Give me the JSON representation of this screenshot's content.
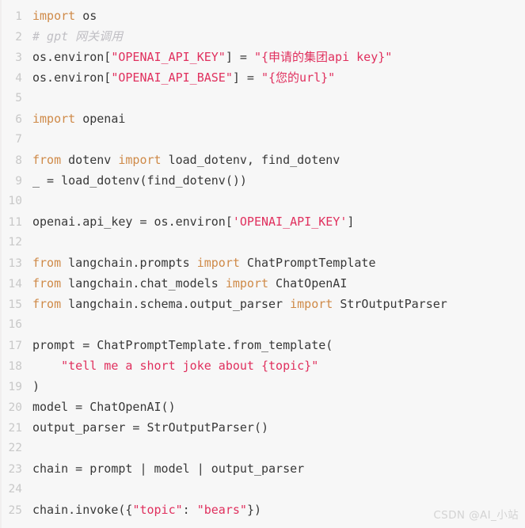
{
  "editor": {
    "language": "python",
    "background_color": "#f7f7f7",
    "default_text_color": "#383838",
    "keyword_color": "#cf8a48",
    "string_color": "#e0305e",
    "comment_color": "#c0bfc4",
    "line_number_color": "#c8c8c8",
    "lines": [
      {
        "number": "1",
        "tokens": [
          {
            "t": "import",
            "c": "kw"
          },
          {
            "t": " os",
            "c": "txt"
          }
        ]
      },
      {
        "number": "2",
        "tokens": [
          {
            "t": "# gpt 网关调用",
            "c": "cmt"
          }
        ]
      },
      {
        "number": "3",
        "tokens": [
          {
            "t": "os.environ[",
            "c": "txt"
          },
          {
            "t": "\"OPENAI_API_KEY\"",
            "c": "str"
          },
          {
            "t": "] = ",
            "c": "txt"
          },
          {
            "t": "\"{申请的集团api key}\"",
            "c": "str"
          }
        ]
      },
      {
        "number": "4",
        "tokens": [
          {
            "t": "os.environ[",
            "c": "txt"
          },
          {
            "t": "\"OPENAI_API_BASE\"",
            "c": "str"
          },
          {
            "t": "] = ",
            "c": "txt"
          },
          {
            "t": "\"{您的url}\"",
            "c": "str"
          }
        ]
      },
      {
        "number": "5",
        "tokens": []
      },
      {
        "number": "6",
        "tokens": [
          {
            "t": "import",
            "c": "kw"
          },
          {
            "t": " openai",
            "c": "txt"
          }
        ]
      },
      {
        "number": "7",
        "tokens": []
      },
      {
        "number": "8",
        "tokens": [
          {
            "t": "from",
            "c": "kw"
          },
          {
            "t": " dotenv ",
            "c": "txt"
          },
          {
            "t": "import",
            "c": "kw"
          },
          {
            "t": " load_dotenv, find_dotenv",
            "c": "txt"
          }
        ]
      },
      {
        "number": "9",
        "tokens": [
          {
            "t": "_ = load_dotenv(find_dotenv())",
            "c": "txt"
          }
        ]
      },
      {
        "number": "10",
        "tokens": []
      },
      {
        "number": "11",
        "tokens": [
          {
            "t": "openai.api_key = os.environ[",
            "c": "txt"
          },
          {
            "t": "'OPENAI_API_KEY'",
            "c": "str"
          },
          {
            "t": "]",
            "c": "txt"
          }
        ]
      },
      {
        "number": "12",
        "tokens": []
      },
      {
        "number": "13",
        "tokens": [
          {
            "t": "from",
            "c": "kw"
          },
          {
            "t": " langchain.prompts ",
            "c": "txt"
          },
          {
            "t": "import",
            "c": "kw"
          },
          {
            "t": " ChatPromptTemplate",
            "c": "txt"
          }
        ]
      },
      {
        "number": "14",
        "tokens": [
          {
            "t": "from",
            "c": "kw"
          },
          {
            "t": " langchain.chat_models ",
            "c": "txt"
          },
          {
            "t": "import",
            "c": "kw"
          },
          {
            "t": " ChatOpenAI",
            "c": "txt"
          }
        ]
      },
      {
        "number": "15",
        "tokens": [
          {
            "t": "from",
            "c": "kw"
          },
          {
            "t": " langchain.schema.output_parser ",
            "c": "txt"
          },
          {
            "t": "import",
            "c": "kw"
          },
          {
            "t": " StrOutputParser",
            "c": "txt"
          }
        ]
      },
      {
        "number": "16",
        "tokens": []
      },
      {
        "number": "17",
        "tokens": [
          {
            "t": "prompt = ChatPromptTemplate.from_template(",
            "c": "txt"
          }
        ]
      },
      {
        "number": "18",
        "tokens": [
          {
            "t": "    ",
            "c": "txt"
          },
          {
            "t": "\"tell me a short joke about {topic}\"",
            "c": "str"
          }
        ]
      },
      {
        "number": "19",
        "tokens": [
          {
            "t": ")",
            "c": "txt"
          }
        ]
      },
      {
        "number": "20",
        "tokens": [
          {
            "t": "model = ChatOpenAI()",
            "c": "txt"
          }
        ]
      },
      {
        "number": "21",
        "tokens": [
          {
            "t": "output_parser = StrOutputParser()",
            "c": "txt"
          }
        ]
      },
      {
        "number": "22",
        "tokens": []
      },
      {
        "number": "23",
        "tokens": [
          {
            "t": "chain = prompt | model | output_parser",
            "c": "txt"
          }
        ]
      },
      {
        "number": "24",
        "tokens": []
      },
      {
        "number": "25",
        "tokens": [
          {
            "t": "chain.invoke({",
            "c": "txt"
          },
          {
            "t": "\"topic\"",
            "c": "str"
          },
          {
            "t": ": ",
            "c": "txt"
          },
          {
            "t": "\"bears\"",
            "c": "str"
          },
          {
            "t": "})",
            "c": "txt"
          }
        ]
      }
    ]
  },
  "watermark": {
    "text": "CSDN @AI_小站"
  }
}
